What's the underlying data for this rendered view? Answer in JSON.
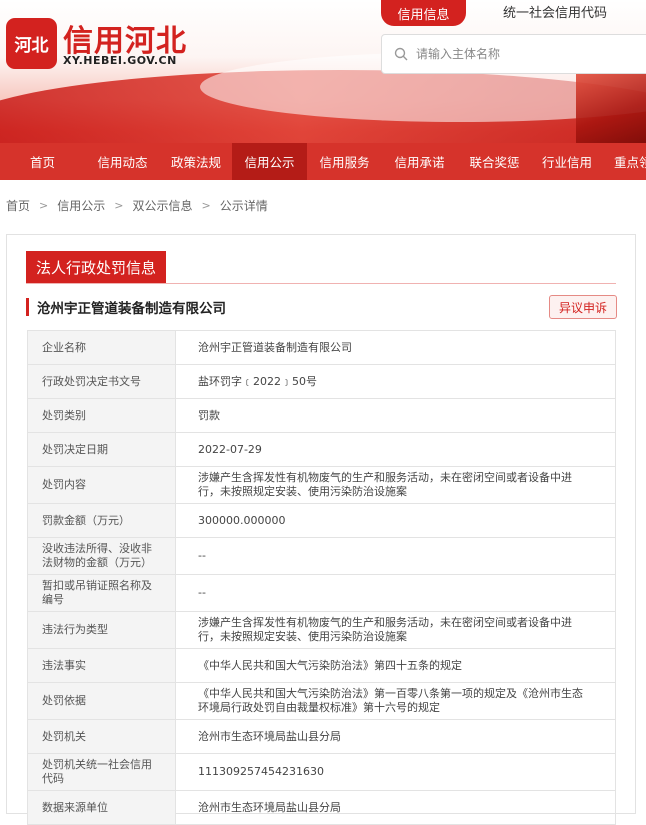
{
  "header": {
    "logo_glyph": "河北",
    "site_title": "信用河北",
    "site_url": "XY.HEBEI.GOV.CN",
    "tab_credit_info": "信用信息",
    "tab_unified_code": "统一社会信用代码",
    "search_placeholder": "请输入主体名称"
  },
  "nav": {
    "items": [
      {
        "label": "首页"
      },
      {
        "label": "信用动态"
      },
      {
        "label": "政策法规"
      },
      {
        "label": "信用公示"
      },
      {
        "label": "信用服务"
      },
      {
        "label": "信用承诺"
      },
      {
        "label": "联合奖惩"
      },
      {
        "label": "行业信用"
      },
      {
        "label": "重点领"
      }
    ]
  },
  "breadcrumb": {
    "items": [
      "首页",
      "信用公示",
      "双公示信息",
      "公示详情"
    ]
  },
  "detail": {
    "section_title": "法人行政处罚信息",
    "company_name": "沧州宇正管道装备制造有限公司",
    "objection_button": "异议申诉",
    "rows": [
      {
        "key": "企业名称",
        "value": "沧州宇正管道装备制造有限公司"
      },
      {
        "key": "行政处罚决定书文号",
        "value": "盐环罚字﹝2022﹞50号"
      },
      {
        "key": "处罚类别",
        "value": "罚款"
      },
      {
        "key": "处罚决定日期",
        "value": "2022-07-29"
      },
      {
        "key": "处罚内容",
        "value": "涉嫌产生含挥发性有机物废气的生产和服务活动，未在密闭空间或者设备中进行，未按照规定安装、使用污染防治设施案"
      },
      {
        "key": "罚款金额（万元）",
        "value": "300000.000000"
      },
      {
        "key": "没收违法所得、没收非法财物的金额（万元）",
        "value": "--"
      },
      {
        "key": "暂扣或吊销证照名称及编号",
        "value": "--"
      },
      {
        "key": "违法行为类型",
        "value": "涉嫌产生含挥发性有机物废气的生产和服务活动，未在密闭空间或者设备中进行，未按照规定安装、使用污染防治设施案"
      },
      {
        "key": "违法事实",
        "value": "《中华人民共和国大气污染防治法》第四十五条的规定"
      },
      {
        "key": "处罚依据",
        "value": "《中华人民共和国大气污染防治法》第一百零八条第一项的规定及《沧州市生态环境局行政处罚自由裁量权标准》第十六号的规定"
      },
      {
        "key": "处罚机关",
        "value": "沧州市生态环境局盐山县分局"
      },
      {
        "key": "处罚机关统一社会信用代码",
        "value": "111309257454231630"
      },
      {
        "key": "数据来源单位",
        "value": "沧州市生态环境局盐山县分局"
      }
    ]
  },
  "colors": {
    "brand_red": "#d3221f",
    "nav_red": "#d6332b",
    "nav_active": "#b41c17"
  }
}
